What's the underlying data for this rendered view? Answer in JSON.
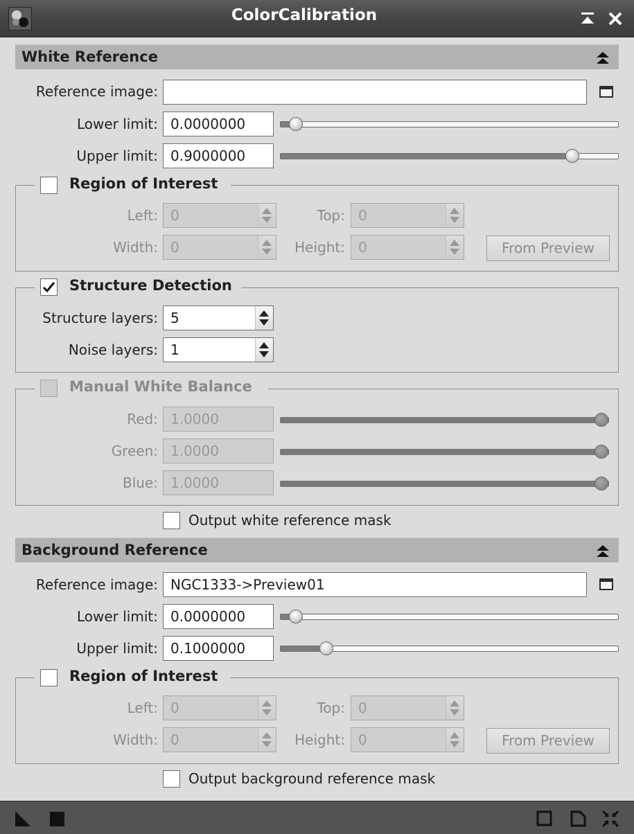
{
  "window": {
    "title": "ColorCalibration"
  },
  "icons": {
    "app": "color-calibration-app-icon",
    "minimize": "minimize-icon",
    "close": "close-icon",
    "collapse": "collapse-section-icon",
    "view_picker": "view-picker-icon",
    "new_instance": "new-instance-triangle-icon",
    "apply_global": "apply-global-square-icon",
    "preview": "real-time-preview-icon",
    "reset": "reset-icon",
    "resize": "restore-size-icon"
  },
  "white_reference": {
    "section_title": "White Reference",
    "reference_image_label": "Reference image:",
    "reference_image_value": "",
    "lower_limit_label": "Lower limit:",
    "lower_limit_value": "0.0000000",
    "lower_limit_fraction": 0.0,
    "upper_limit_label": "Upper limit:",
    "upper_limit_value": "0.9000000",
    "upper_limit_fraction": 0.9,
    "roi": {
      "title": "Region of Interest",
      "checked": false,
      "left_label": "Left:",
      "left_value": "0",
      "top_label": "Top:",
      "top_value": "0",
      "width_label": "Width:",
      "width_value": "0",
      "height_label": "Height:",
      "height_value": "0",
      "from_preview_label": "From Preview"
    },
    "structure_detection": {
      "title": "Structure Detection",
      "checked": true,
      "structure_layers_label": "Structure layers:",
      "structure_layers_value": "5",
      "noise_layers_label": "Noise layers:",
      "noise_layers_value": "1"
    },
    "manual_white_balance": {
      "title": "Manual White Balance",
      "checked": false,
      "red_label": "Red:",
      "red_value": "1.0000",
      "red_fraction": 1.0,
      "green_label": "Green:",
      "green_value": "1.0000",
      "green_fraction": 1.0,
      "blue_label": "Blue:",
      "blue_value": "1.0000",
      "blue_fraction": 1.0
    },
    "output_mask_label": "Output white reference mask",
    "output_mask_checked": false
  },
  "background_reference": {
    "section_title": "Background Reference",
    "reference_image_label": "Reference image:",
    "reference_image_value": "NGC1333->Preview01",
    "lower_limit_label": "Lower limit:",
    "lower_limit_value": "0.0000000",
    "lower_limit_fraction": 0.0,
    "upper_limit_label": "Upper limit:",
    "upper_limit_value": "0.1000000",
    "upper_limit_fraction": 0.1,
    "roi": {
      "title": "Region of Interest",
      "checked": false,
      "left_label": "Left:",
      "left_value": "0",
      "top_label": "Top:",
      "top_value": "0",
      "width_label": "Width:",
      "width_value": "0",
      "height_label": "Height:",
      "height_value": "0",
      "from_preview_label": "From Preview"
    },
    "output_mask_label": "Output background reference mask",
    "output_mask_checked": false
  }
}
